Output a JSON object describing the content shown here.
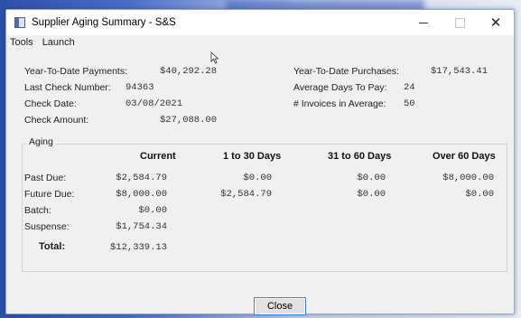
{
  "window": {
    "title": "Supplier Aging Summary - S&S",
    "close_glyph": "✕"
  },
  "menu": [
    "Tools",
    "Launch"
  ],
  "summary": {
    "ytd_payments_label": "Year-To-Date Payments:",
    "ytd_payments_value": "$40,292.28",
    "last_check_number_label": "Last Check Number:",
    "last_check_number_value": "94363",
    "check_date_label": "Check Date:",
    "check_date_value": "03/08/2021",
    "check_amount_label": "Check Amount:",
    "check_amount_value": "$27,088.00",
    "ytd_purchases_label": "Year-To-Date Purchases:",
    "ytd_purchases_value": "$17,543.41",
    "avg_days_label": "Average Days To Pay:",
    "avg_days_value": "24",
    "invoices_label": "# Invoices in Average:",
    "invoices_value": "50"
  },
  "aging": {
    "legend": "Aging",
    "columns": [
      "Current",
      "1 to 30 Days",
      "31 to 60 Days",
      "Over 60 Days"
    ],
    "rows": [
      {
        "label": "Past Due:",
        "values": [
          "$2,584.79",
          "$0.00",
          "$0.00",
          "$8,000.00"
        ]
      },
      {
        "label": "Future Due:",
        "values": [
          "$8,000.00",
          "$2,584.79",
          "$0.00",
          "$0.00"
        ]
      },
      {
        "label": "Batch:",
        "values": [
          "$0.00",
          "",
          "",
          ""
        ]
      },
      {
        "label": "Suspense:",
        "values": [
          "$1,754.34",
          "",
          "",
          ""
        ]
      }
    ],
    "total_label": "Total:",
    "total_value": "$12,339.13"
  },
  "close_button": "Close",
  "colors": {
    "accent": "#3c7fd6",
    "window_bg": "#f0f0f0"
  }
}
